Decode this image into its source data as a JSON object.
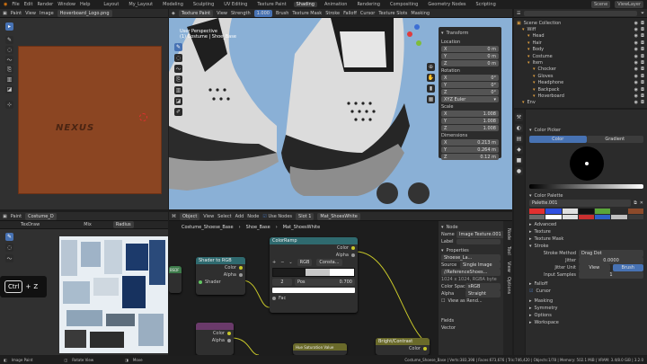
{
  "menu": {
    "items": [
      "File",
      "Edit",
      "Render",
      "Window",
      "Help"
    ],
    "workspaces": [
      "Layout",
      "My_Layout",
      "Modeling",
      "Sculpting",
      "UV Editing",
      "Texture Paint",
      "Shading",
      "Animation",
      "Rendering",
      "Compositing",
      "Geometry Nodes",
      "Scripting"
    ],
    "active_workspace": "Shading",
    "scene": "Scene",
    "view_layer": "ViewLayer"
  },
  "image_editor": {
    "mode": "Paint",
    "view": "View",
    "image": "Image",
    "image_name": "Hoverboard_Logo.png",
    "logo_text": "NEXUS"
  },
  "viewport": {
    "mode": "Texture Paint",
    "view": "View",
    "brush_label": "TexDraw",
    "strength_label": "Strength",
    "strength_value": "1.000",
    "brush": "Brush",
    "texture_mask": "Texture Mask",
    "stroke": "Stroke",
    "falloff": "Falloff",
    "cursor": "Cursor",
    "texture_slots": "Texture Slots",
    "masking": "Masking",
    "overlay_title": "User Perspective",
    "overlay_sub": "(1) Costume | Shoe_Base"
  },
  "transform": {
    "title": "Transform",
    "location_label": "Location",
    "location": [
      {
        "axis": "X",
        "value": "0 m"
      },
      {
        "axis": "Y",
        "value": "0 m"
      },
      {
        "axis": "Z",
        "value": "0 m"
      }
    ],
    "rotation_label": "Rotation",
    "rotation": [
      {
        "axis": "X",
        "value": "0°"
      },
      {
        "axis": "Y",
        "value": "0°"
      },
      {
        "axis": "Z",
        "value": "0°"
      }
    ],
    "rotation_mode": "XYZ Euler",
    "scale_label": "Scale",
    "scale": [
      {
        "axis": "X",
        "value": "1.008"
      },
      {
        "axis": "Y",
        "value": "1.008"
      },
      {
        "axis": "Z",
        "value": "1.008"
      }
    ],
    "dimensions_label": "Dimensions",
    "dimensions": [
      {
        "axis": "X",
        "value": "0.213 m"
      },
      {
        "axis": "Y",
        "value": "0.264 m"
      },
      {
        "axis": "Z",
        "value": "0.12 m"
      }
    ]
  },
  "uv_editor": {
    "mode": "Paint",
    "object": "Costume_D",
    "brush": "TexDraw",
    "blend": "Mix",
    "radius": "Radius"
  },
  "node_editor": {
    "object": "Object",
    "view": "View",
    "select": "Select",
    "add": "Add",
    "node": "Node",
    "use_nodes": "Use Nodes",
    "slot": "Slot 1",
    "material": "Mat_ShoesWhite",
    "breadcrumb": [
      "Costume_Shoese_Base",
      "Shoe_Base",
      "Mat_ShoesWhite"
    ],
    "nodes": {
      "shader_to_rgb": {
        "title": "Shader to RGB",
        "out1": "Color",
        "out2": "Alpha",
        "in": "Shader"
      },
      "color_ramp": {
        "title": "ColorRamp",
        "out1": "Color",
        "out2": "Alpha",
        "interp": "RGB",
        "mode": "Consta...",
        "index": "2",
        "pos_label": "Pos",
        "pos_value": "0.700",
        "in": "Fac"
      },
      "mix": {
        "out1": "Color",
        "out2": "Alpha"
      },
      "hsv": {
        "title": "Hue Saturation Value"
      },
      "bright_contrast": {
        "title": "Bright/Contrast",
        "out": "Color"
      },
      "left_stub": "BSDF"
    }
  },
  "node_panel": {
    "section": "Node",
    "name_label": "Name",
    "name_value": "Image Texture.001",
    "label_label": "Label",
    "properties": "Properties",
    "image_name": "Shoese_La...",
    "source_label": "Source",
    "source_value": "Single Image",
    "path": "//ReferenceShoes...",
    "size": "1024 x 1024, RGBA byte",
    "color_space_label": "Color Space",
    "color_space": "sRGB",
    "alpha_label": "Alpha",
    "alpha_value": "Straight",
    "view_as_render": "View as Rend...",
    "fields": [
      "Fields",
      "Vector"
    ],
    "side_tabs": [
      "Node",
      "Tool",
      "View",
      "Options"
    ]
  },
  "outliner": {
    "scene": "Scene",
    "items": [
      {
        "name": "Scene Collection",
        "depth": 0
      },
      {
        "name": "Wiff",
        "depth": 1
      },
      {
        "name": "Head",
        "depth": 2
      },
      {
        "name": "Hair",
        "depth": 2
      },
      {
        "name": "Body",
        "depth": 2
      },
      {
        "name": "Costume",
        "depth": 2
      },
      {
        "name": "Item",
        "depth": 2
      },
      {
        "name": "Chocker",
        "depth": 3
      },
      {
        "name": "Gloves",
        "depth": 3
      },
      {
        "name": "Headphone",
        "depth": 3
      },
      {
        "name": "Backpack",
        "depth": 3
      },
      {
        "name": "Hoverboard",
        "depth": 3
      },
      {
        "name": "Env",
        "depth": 1
      }
    ]
  },
  "properties": {
    "color_picker": "Color Picker",
    "color_tab": "Color",
    "gradient_tab": "Gradient",
    "color_palette": "Color Palette",
    "palette_name": "Palette.001",
    "palette_colors": [
      "#e23030",
      "#3050e0",
      "#e0e0e0",
      "#111111",
      "#5aa53a",
      "#2a2a2a",
      "#8c4a2a",
      "#6a6a6a",
      "#ffffff",
      "#e0e0e0",
      "#c93030",
      "#2d60c8",
      "#c0c0c0",
      "#3a3a3a"
    ],
    "sections": [
      "Advanced",
      "Texture",
      "Texture Mask",
      "Stroke"
    ],
    "stroke_method_label": "Stroke Method",
    "stroke_method": "Drag Dot",
    "jitter_label": "Jitter",
    "jitter_value": "0.0000",
    "jitter_unit_label": "Jitter Unit",
    "jitter_unit_view": "View",
    "jitter_unit_brush": "Brush",
    "input_samples_label": "Input Samples",
    "input_samples": "1",
    "falloff": "Falloff",
    "cursor": "Cursor",
    "more": [
      "Masking",
      "Symmetry",
      "Options",
      "Workspace"
    ]
  },
  "status": {
    "left": "Image Paint",
    "mid": "Rotate View",
    "right": "Move",
    "stats": "Costume_Shoese_Base | Verts:383,398 | Faces:673,676 | Tris:746,420 | Objects:1/78 | Memory: 502.1 MiB | VRAM: 3.4/8.0 GiB | 3.2.0"
  },
  "shortcut": {
    "key1": "Ctrl",
    "plus": "+",
    "key2": "Z"
  }
}
